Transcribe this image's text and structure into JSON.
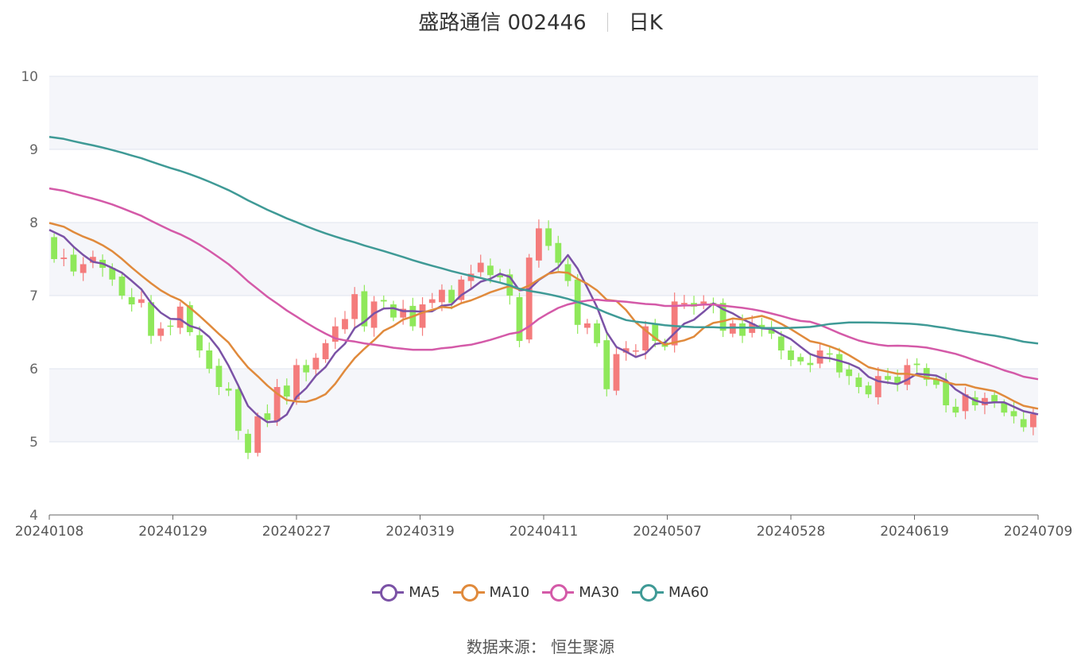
{
  "chart_data": {
    "type": "candlestick",
    "title": "盛路通信 002446",
    "subtitle": "日K",
    "ylim": [
      4,
      10
    ],
    "yticks": [
      4,
      5,
      6,
      7,
      8,
      9,
      10
    ],
    "x_tick_labels": [
      "20240108",
      "20240129",
      "20240227",
      "20240319",
      "20240411",
      "20240507",
      "20240528",
      "20240619",
      "20240709"
    ],
    "grid": true,
    "up_color": "#f47c7c",
    "down_color": "#8fe85a",
    "closes": [
      7.5,
      7.52,
      7.33,
      7.43,
      7.53,
      7.38,
      7.22,
      7.0,
      6.88,
      6.95,
      6.45,
      6.55,
      6.58,
      6.85,
      6.5,
      6.25,
      6.0,
      5.75,
      5.7,
      5.15,
      4.85,
      5.35,
      5.3,
      5.75,
      5.62,
      6.05,
      5.95,
      6.15,
      6.35,
      6.58,
      6.68,
      7.02,
      6.58,
      6.92,
      6.92,
      6.7,
      6.82,
      6.58,
      6.88,
      6.95,
      7.08,
      6.9,
      7.22,
      7.3,
      7.45,
      7.28,
      7.25,
      7.0,
      6.38,
      7.52,
      7.92,
      7.68,
      7.45,
      7.2,
      6.6,
      6.62,
      6.35,
      5.72,
      6.2,
      6.28,
      6.25,
      6.58,
      6.38,
      6.3,
      6.92,
      6.9,
      6.85,
      6.92,
      6.88,
      6.52,
      6.62,
      6.45,
      6.62,
      6.55,
      6.48,
      6.25,
      6.12,
      6.1,
      6.05,
      6.25,
      6.2,
      5.95,
      5.9,
      5.75,
      5.65,
      5.9,
      5.85,
      5.8,
      6.05,
      6.05,
      5.85,
      5.78,
      5.5,
      5.4,
      5.65,
      5.5,
      5.6,
      5.55,
      5.4,
      5.35,
      5.2,
      5.38
    ]
  },
  "legend": [
    {
      "label": "MA5",
      "color": "#7b52a6"
    },
    {
      "label": "MA10",
      "color": "#e08a3c"
    },
    {
      "label": "MA30",
      "color": "#d45aa8"
    },
    {
      "label": "MA60",
      "color": "#3f9a96"
    }
  ],
  "footer": {
    "source": "数据来源： 恒生聚源"
  }
}
